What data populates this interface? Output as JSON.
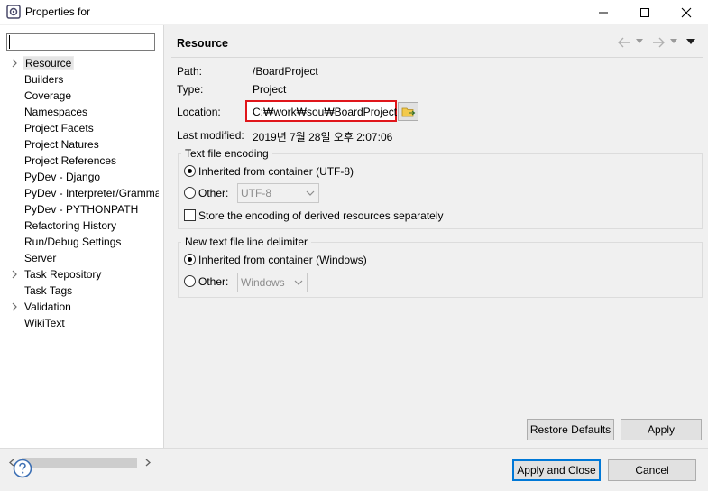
{
  "window": {
    "title": "Properties for",
    "minimize_icon": "minimize-icon",
    "maximize_icon": "maximize-icon",
    "close_icon": "close-icon"
  },
  "sidebar": {
    "filter_value": "",
    "items": [
      {
        "label": "Resource",
        "expandable": true,
        "selected": true
      },
      {
        "label": "Builders",
        "expandable": false
      },
      {
        "label": "Coverage",
        "expandable": false
      },
      {
        "label": "Namespaces",
        "expandable": false
      },
      {
        "label": "Project Facets",
        "expandable": false
      },
      {
        "label": "Project Natures",
        "expandable": false
      },
      {
        "label": "Project References",
        "expandable": false
      },
      {
        "label": "PyDev - Django",
        "expandable": false
      },
      {
        "label": "PyDev - Interpreter/Grammar",
        "expandable": false
      },
      {
        "label": "PyDev - PYTHONPATH",
        "expandable": false
      },
      {
        "label": "Refactoring History",
        "expandable": false
      },
      {
        "label": "Run/Debug Settings",
        "expandable": false
      },
      {
        "label": "Server",
        "expandable": false
      },
      {
        "label": "Task Repository",
        "expandable": true
      },
      {
        "label": "Task Tags",
        "expandable": false
      },
      {
        "label": "Validation",
        "expandable": true
      },
      {
        "label": "WikiText",
        "expandable": false
      }
    ]
  },
  "page": {
    "title": "Resource",
    "path_label": "Path:",
    "path_value": "/BoardProject",
    "type_label": "Type:",
    "type_value": "Project",
    "location_label": "Location:",
    "location_value": "C:₩work₩sou₩BoardProject",
    "last_modified_label": "Last modified:",
    "last_modified_value": "2019년 7월 28일 오후 2:07:06"
  },
  "encoding": {
    "group_title": "Text file encoding",
    "inherited_label": "Inherited from container (UTF-8)",
    "other_label": "Other:",
    "other_value": "UTF-8",
    "store_label": "Store the encoding of derived resources separately",
    "inherited_selected": true,
    "store_checked": false
  },
  "delimiter": {
    "group_title": "New text file line delimiter",
    "inherited_label": "Inherited from container (Windows)",
    "other_label": "Other:",
    "other_value": "Windows",
    "inherited_selected": true
  },
  "buttons": {
    "restore_defaults": "Restore Defaults",
    "apply": "Apply",
    "apply_and_close": "Apply and Close",
    "cancel": "Cancel"
  },
  "colors": {
    "highlight_border": "#e0161b",
    "default_button_border": "#0078d7",
    "help_icon": "#3c6fb4"
  }
}
